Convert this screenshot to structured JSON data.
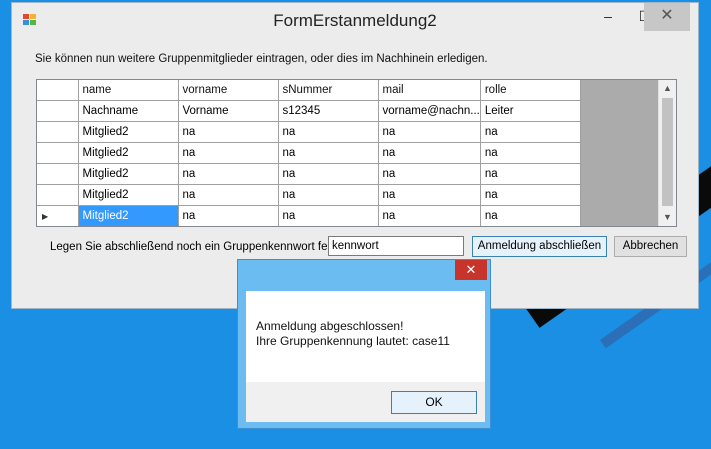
{
  "window": {
    "title": "FormErstanmeldung2",
    "controls": {
      "minimize": "–",
      "maximize": "☐",
      "close": "✕"
    }
  },
  "info_text": "Sie können nun weitere Gruppenmitglieder eintragen, oder dies im Nachhinein erledigen.",
  "grid": {
    "columns": [
      "name",
      "vorname",
      "sNummer",
      "mail",
      "rolle"
    ],
    "rows": [
      [
        "Nachname",
        "Vorname",
        "s12345",
        "vorname@nachn...",
        "Leiter"
      ],
      [
        "Mitglied2",
        "na",
        "na",
        "na",
        "na"
      ],
      [
        "Mitglied2",
        "na",
        "na",
        "na",
        "na"
      ],
      [
        "Mitglied2",
        "na",
        "na",
        "na",
        "na"
      ],
      [
        "Mitglied2",
        "na",
        "na",
        "na",
        "na"
      ],
      [
        "Mitglied2",
        "na",
        "na",
        "na",
        "na"
      ]
    ]
  },
  "password": {
    "label": "Legen Sie abschließend noch ein Gruppenkennwort fest:",
    "value": "kennwort"
  },
  "buttons": {
    "submit": "Anmeldung abschließen",
    "cancel": "Abbrechen"
  },
  "dialog": {
    "line1": "Anmeldung abgeschlossen!",
    "line2": "Ihre Gruppenkennung lautet: case11",
    "ok": "OK",
    "close": "✕"
  },
  "colors": {
    "desktop": "#1a8fe3",
    "selection": "#3399ff",
    "dialog_frame": "#6bbcf1",
    "close_red": "#c7342b"
  }
}
